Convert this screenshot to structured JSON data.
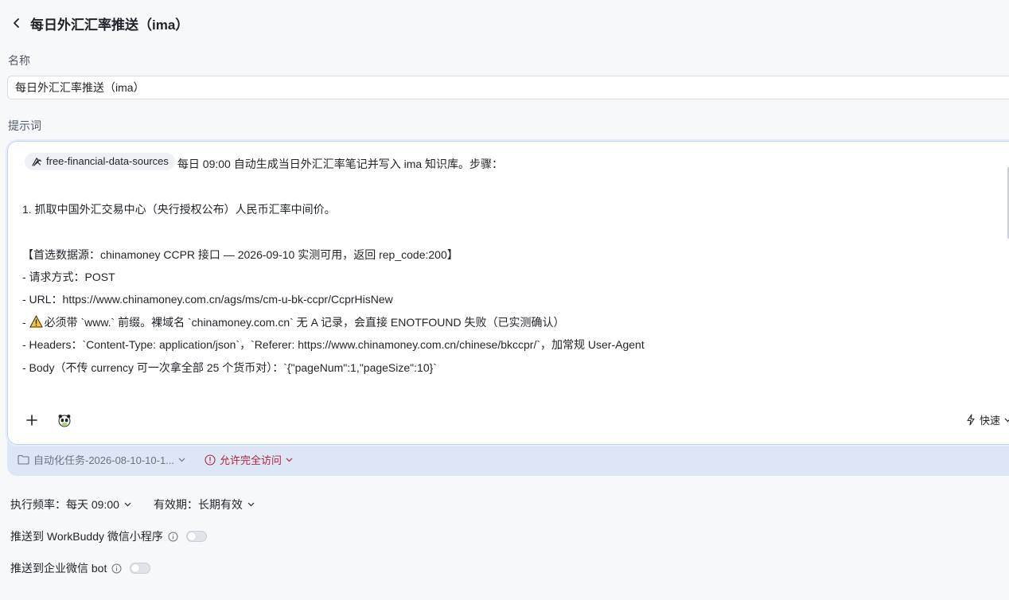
{
  "header": {
    "title": "每日外汇汇率推送（ima）"
  },
  "name_field": {
    "label": "名称",
    "value": "每日外汇汇率推送（ima）"
  },
  "prompt": {
    "label": "提示词",
    "skill_chip": "free-financial-data-sources",
    "first_line": "每日 09:00 自动生成当日外汇汇率笔记并写入 ima 知识库。步骤：",
    "lines": [
      "",
      "1. 抓取中国外汇交易中心（央行授权公布）人民币汇率中间价。",
      "",
      "【首选数据源：chinamoney CCPR 接口 — 2026-09-10 实测可用，返回 rep_code:200】",
      "- 请求方式：POST",
      "- URL：https://www.chinamoney.com.cn/ags/ms/cm-u-bk-ccpr/CcprHisNew"
    ],
    "warn_prefix": "- ",
    "warn_text": "必须带 `www.` 前缀。裸域名 `chinamoney.com.cn` 无 A 记录，会直接 ENOTFOUND 失败（已实测确认）",
    "lines_after": [
      "- Headers：`Content-Type: application/json`，`Referer: https://www.chinamoney.com.cn/chinese/bkccpr/`，加常规 User-Agent",
      "- Body（不传 currency 可一次拿全部 25 个货币对）：`{\"pageNum\":1,\"pageSize\":10}`"
    ],
    "mode_label": "快速"
  },
  "meta": {
    "folder": "自动化任务-2026-08-10-10-1...",
    "access": "允许完全访问"
  },
  "settings": {
    "frequency": "执行频率：每天 09:00",
    "validity": "有效期：长期有效"
  },
  "toggles": {
    "workbuddy": {
      "label": "推送到 WorkBuddy 微信小程序",
      "on": false
    },
    "wecom": {
      "label": "推送到企业微信 bot",
      "on": false
    }
  },
  "colors": {
    "accent": "#3370ff",
    "danger": "#b4233c",
    "frame": "#dce6f5"
  }
}
